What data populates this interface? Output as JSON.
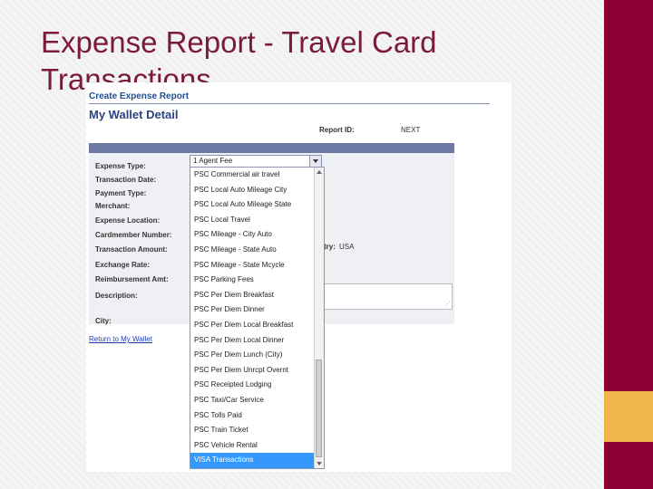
{
  "slide": {
    "title": "Expense Report - Travel Card Transactions"
  },
  "app": {
    "breadcrumb": "Create Expense Report",
    "page_title": "My Wallet Detail",
    "report_id_label": "Report ID:",
    "report_id_value": "NEXT",
    "fields": [
      "Expense Type:",
      "Transaction Date:",
      "Payment Type:",
      "Merchant:",
      "Expense Location:",
      "Cardmember Number:",
      "Transaction Amount:",
      "Exchange Rate:",
      "Reimbursement Amt:",
      "Description:",
      "City:"
    ],
    "country_label": "try:",
    "country_value": "USA",
    "return_link": "Return to My Wallet",
    "expense_type_selected": "1 Agent Fee",
    "dropdown_options": [
      "PSC Commercial air travel",
      "PSC Local Auto Mileage City",
      "PSC Local Auto Mileage State",
      "PSC Local Travel",
      "PSC Mileage - City Auto",
      "PSC Mileage - State Auto",
      "PSC Mileage - State Mcycle",
      "PSC Parking Fees",
      "PSC Per Diem Breakfast",
      "PSC Per Diem Dinner",
      "PSC Per Diem Local Breakfast",
      "PSC Per Diem Local Dinner",
      "PSC Per Diem Lunch (City)",
      "PSC Per Diem Unrcpt Overnt",
      "PSC Receipted Lodging",
      "PSC Taxi/Car Service",
      "PSC Tolls Paid",
      "PSC Train Ticket",
      "PSC Vehicle Rental",
      "VISA Transactions"
    ],
    "highlighted_option": "VISA Transactions"
  },
  "colors": {
    "title_text": "#7a1a3d",
    "band_maroon": "#8c0033",
    "band_gold": "#f1b64b",
    "selection": "#3399ff",
    "header_bar": "#6c79a3"
  }
}
